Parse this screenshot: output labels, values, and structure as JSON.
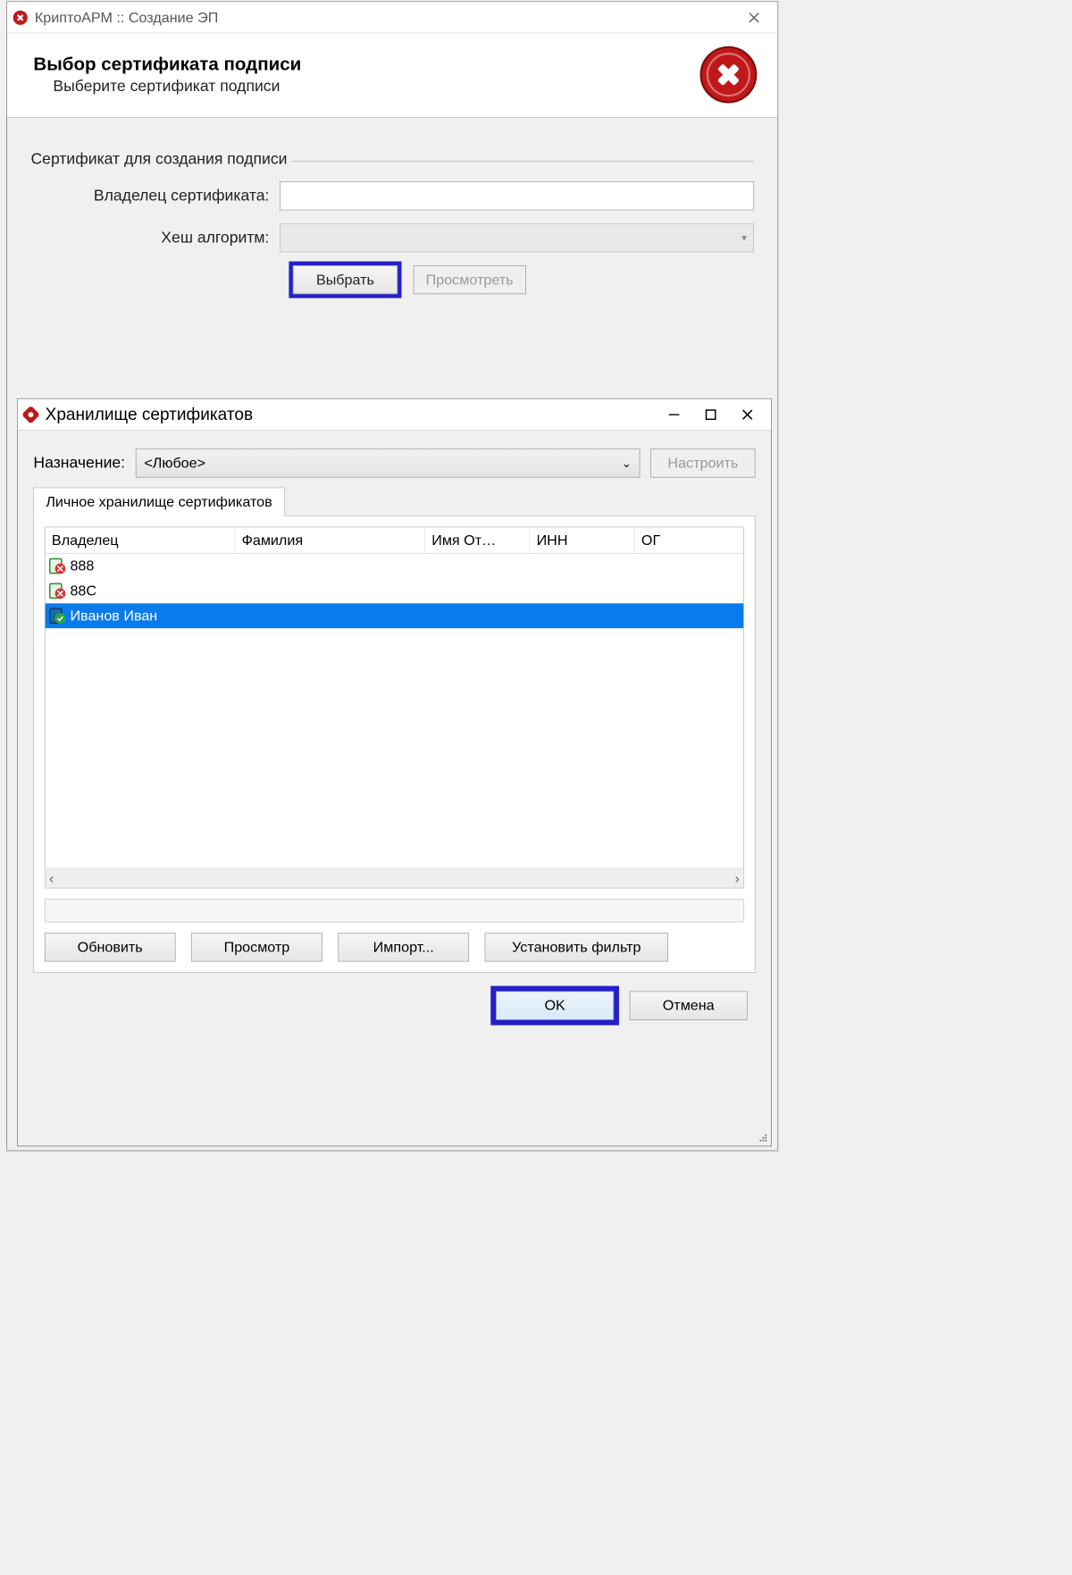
{
  "win1": {
    "title": "КриптоАРМ :: Создание ЭП",
    "heading": "Выбор сертификата подписи",
    "subheading": "Выберите сертификат подписи",
    "group_legend": "Сертификат для создания подписи",
    "owner_label": "Владелец сертификата:",
    "owner_value": "",
    "hash_label": "Хеш алгоритм:",
    "hash_value": "",
    "btn_select": "Выбрать",
    "btn_view": "Просмотреть"
  },
  "win2": {
    "title": "Хранилище сертификатов",
    "purpose_label": "Назначение:",
    "purpose_value": "<Любое>",
    "btn_configure": "Настроить",
    "tab_label": "Личное хранилище сертификатов",
    "columns": {
      "c0": "Владелец",
      "c1": "Фамилия",
      "c2": "Имя От…",
      "c3": "ИНН",
      "c4": "ОГ"
    },
    "rows": {
      "r0": "888",
      "r1": "88C",
      "r2": "Иванов Иван"
    },
    "btn_refresh": "Обновить",
    "btn_view": "Просмотр",
    "btn_import": "Импорт...",
    "btn_filter": "Установить фильтр",
    "btn_ok": "OK",
    "btn_cancel": "Отмена"
  }
}
